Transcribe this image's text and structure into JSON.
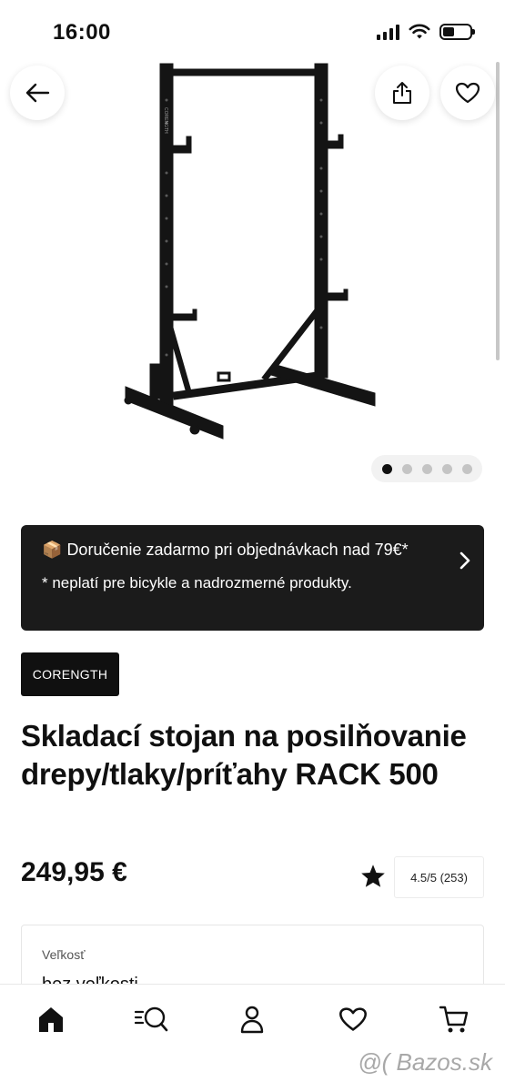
{
  "status_bar": {
    "time": "16:00"
  },
  "product": {
    "image_label": "CORENGTH",
    "carousel": {
      "total": 5,
      "active": 1
    },
    "brand": "CORENGTH",
    "title": "Skladací stojan na posilňovanie drepy/tlaky/príťahy RACK 500",
    "price": "249,95 €",
    "rating": "4.5/5 (253)"
  },
  "delivery_banner": {
    "emoji": "📦",
    "line": "Doručenie zadarmo pri objednávkach nad 79€*",
    "note": "* neplatí pre bicykle a nadrozmerné produkty."
  },
  "size": {
    "label": "Veľkosť",
    "value": "bez veľkosti"
  },
  "bottom_nav": {
    "items": [
      {
        "icon": "home-icon",
        "active": true
      },
      {
        "icon": "search-catalog-icon",
        "active": false
      },
      {
        "icon": "user-icon",
        "active": false
      },
      {
        "icon": "heart-icon",
        "active": false
      },
      {
        "icon": "cart-icon",
        "active": false
      }
    ]
  },
  "watermark": "@( Bazos.sk",
  "colors": {
    "dark": "#1b1b1b",
    "text": "#101010",
    "background": "#ffffff",
    "dot_inactive": "#c4c4c4"
  }
}
